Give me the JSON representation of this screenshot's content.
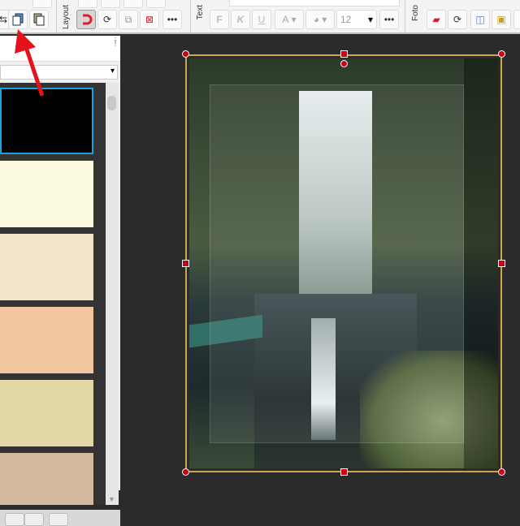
{
  "toolbar": {
    "groups": [
      {
        "label": "Layout"
      },
      {
        "label": "Text"
      },
      {
        "label": "Foto"
      }
    ],
    "text": {
      "bold_label": "F",
      "italic_label": "K",
      "underline_label": "U",
      "font_color_label": "A",
      "font_size": "12",
      "more_label": "•••"
    },
    "layout_more_label": "•••"
  },
  "left_panel": {
    "swatches": [
      "#000000",
      "#fdfbdf",
      "#f2e4c9",
      "#f2c6a0",
      "#e3d6a7",
      "#d4b99d"
    ],
    "selected_index": 0
  },
  "colors": {
    "selection_frame": "#c8a84a",
    "handle": "#c8001a",
    "annotation_arrow": "#e8101a",
    "selected_swatch_border": "#1ea0e0"
  }
}
